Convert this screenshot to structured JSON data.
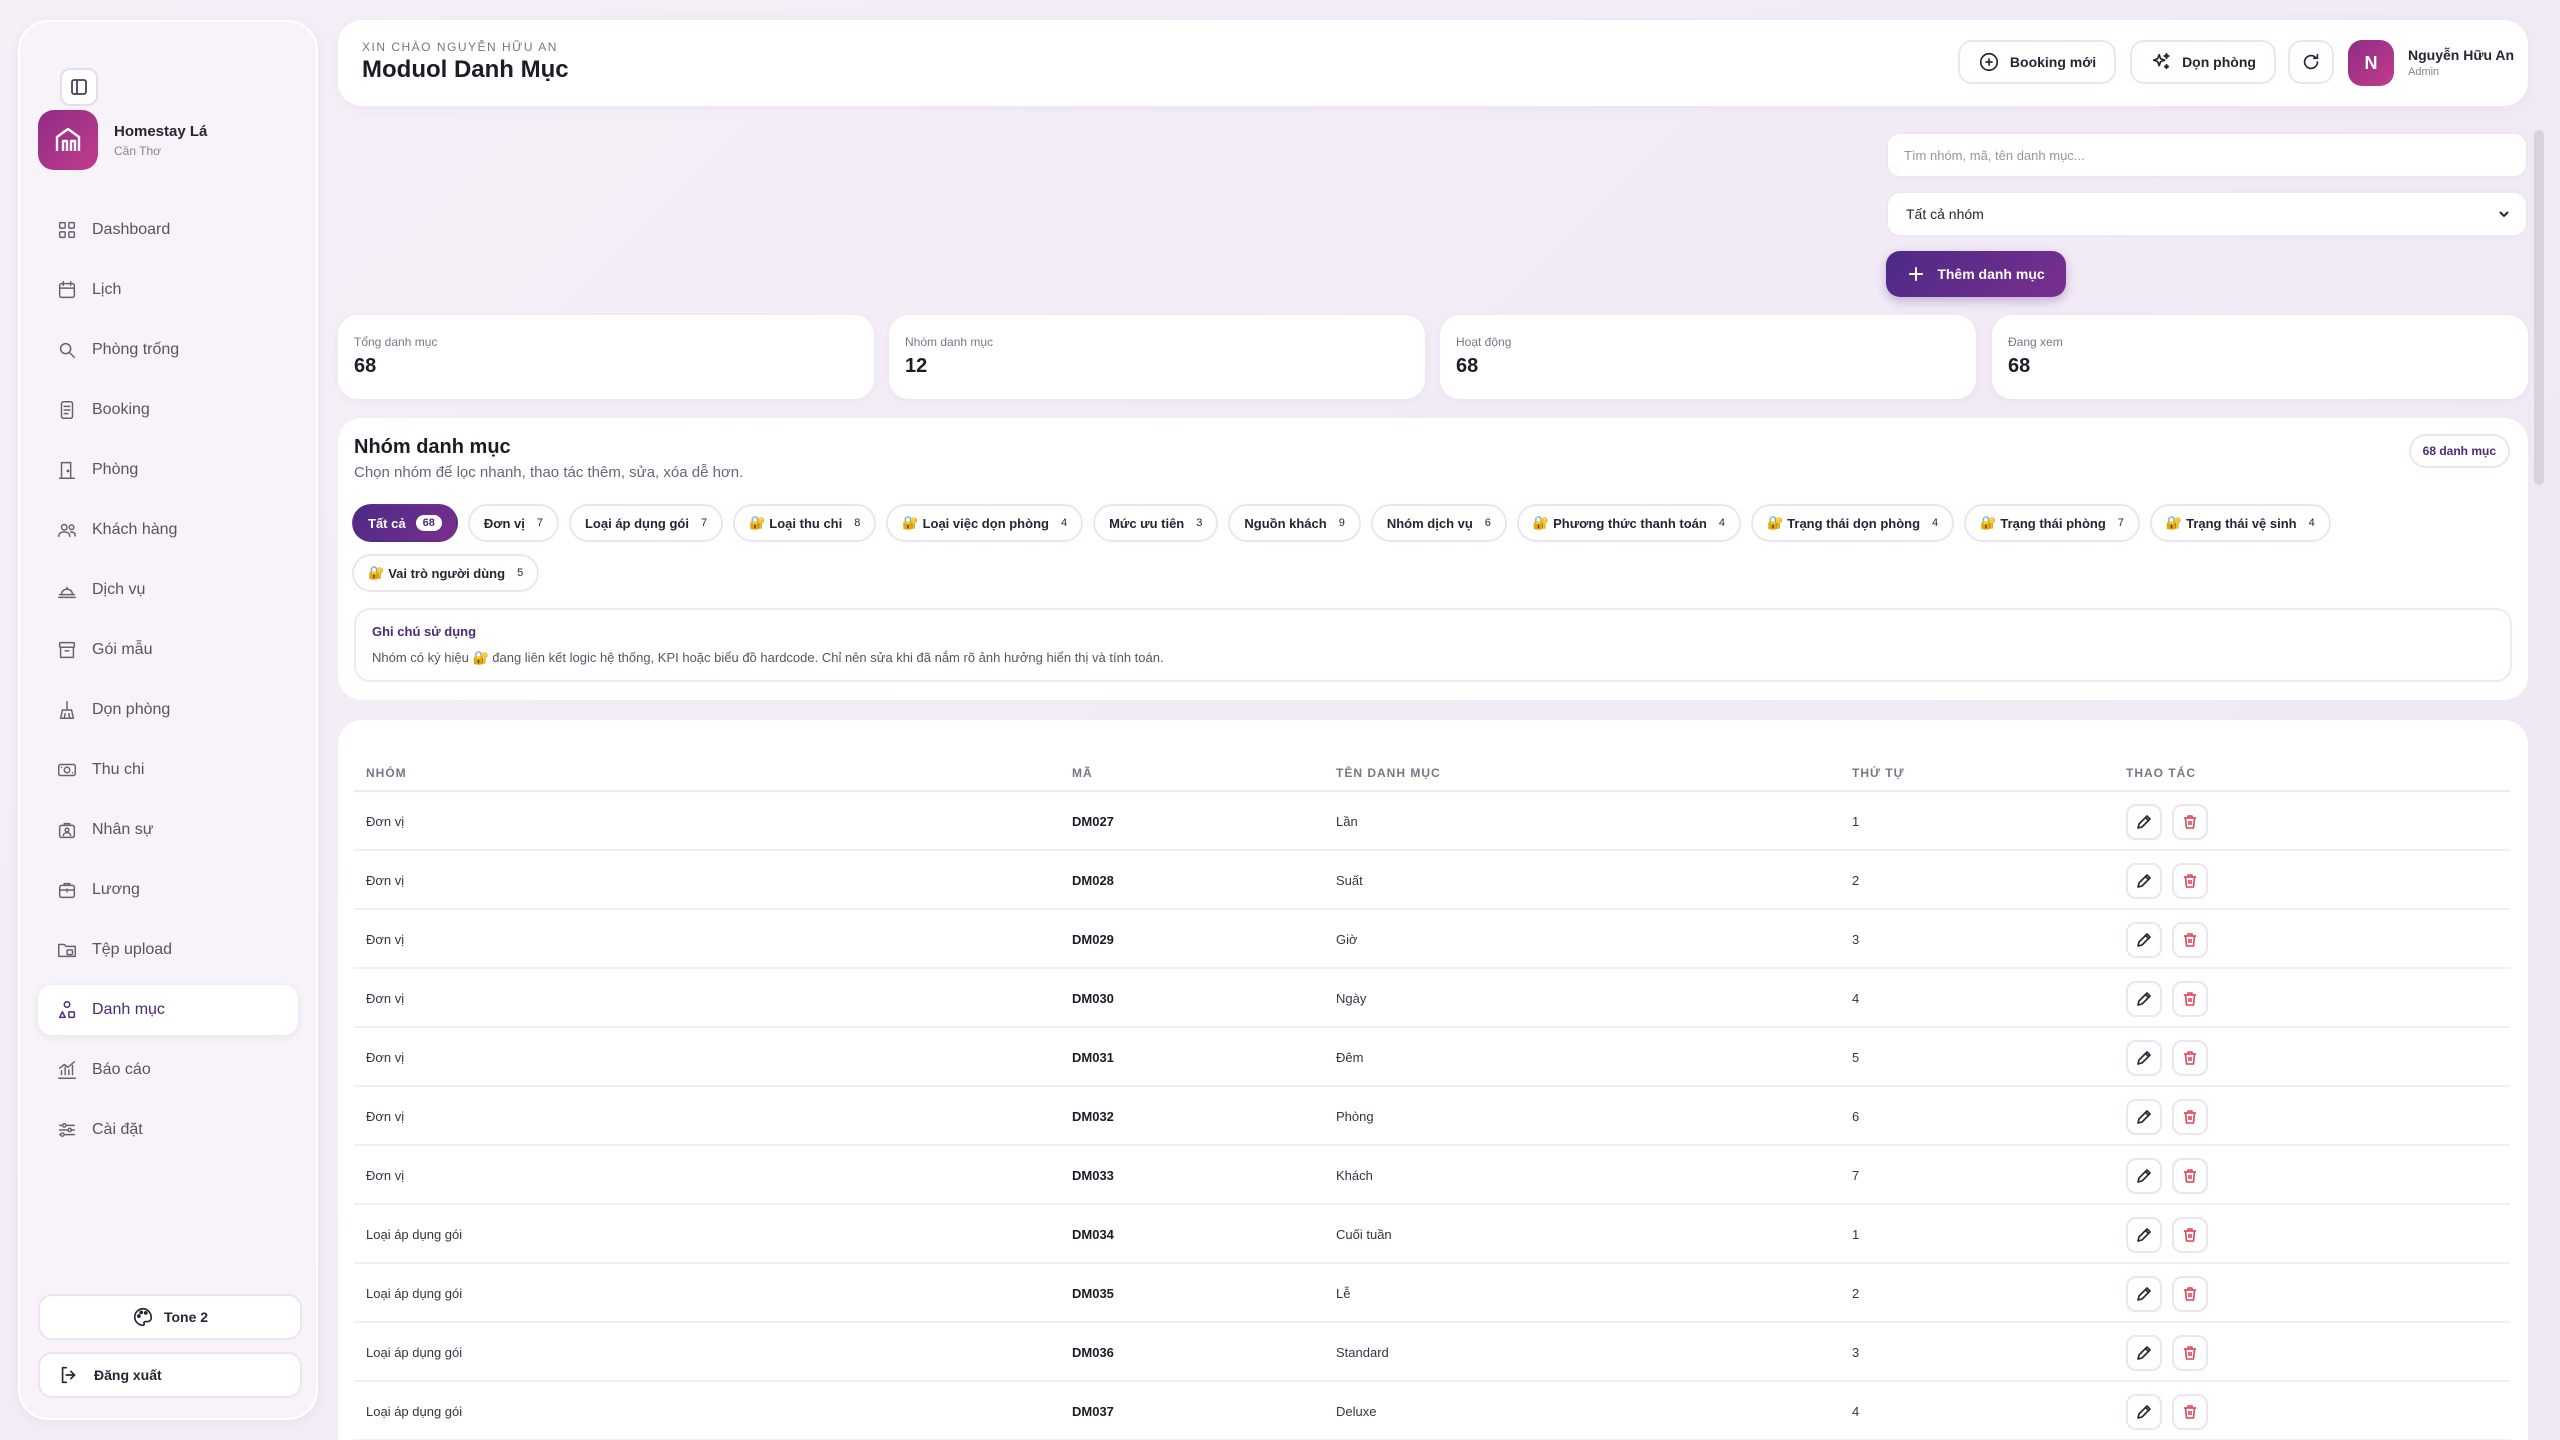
{
  "sidebar": {
    "brand_name": "Homestay Lá",
    "brand_sub": "Cần Thơ",
    "items": [
      {
        "label": "Dashboard",
        "icon": "grid-icon"
      },
      {
        "label": "Lịch",
        "icon": "calendar-icon"
      },
      {
        "label": "Phòng trống",
        "icon": "search-icon"
      },
      {
        "label": "Booking",
        "icon": "booking-icon"
      },
      {
        "label": "Phòng",
        "icon": "door-icon"
      },
      {
        "label": "Khách hàng",
        "icon": "users-icon"
      },
      {
        "label": "Dịch vụ",
        "icon": "service-icon"
      },
      {
        "label": "Gói mẫu",
        "icon": "package-icon"
      },
      {
        "label": "Dọn phòng",
        "icon": "broom-icon"
      },
      {
        "label": "Thu chi",
        "icon": "money-icon"
      },
      {
        "label": "Nhân sự",
        "icon": "staff-icon"
      },
      {
        "label": "Lương",
        "icon": "salary-icon"
      },
      {
        "label": "Tệp upload",
        "icon": "folder-icon"
      },
      {
        "label": "Danh mục",
        "icon": "category-icon"
      },
      {
        "label": "Báo cáo",
        "icon": "chart-icon"
      },
      {
        "label": "Cài đặt",
        "icon": "sliders-icon"
      }
    ],
    "active_index": 13,
    "tone_label": "Tone 2",
    "logout_label": "Đăng xuất"
  },
  "header": {
    "greeting": "XIN CHÀO NGUYỄN HỮU AN",
    "title": "Moduol Danh Mục",
    "booking_label": "Booking mới",
    "clean_label": "Dọn phòng",
    "avatar_initial": "N",
    "user_name": "Nguyễn Hữu An",
    "user_role": "Admin"
  },
  "toolbar": {
    "search_placeholder": "Tìm nhóm, mã, tên danh mục...",
    "filter_value": "Tất cả nhóm",
    "add_label": "Thêm danh mục"
  },
  "stats": [
    {
      "label": "Tổng danh mục",
      "value": "68"
    },
    {
      "label": "Nhóm danh mục",
      "value": "12"
    },
    {
      "label": "Hoạt động",
      "value": "68"
    },
    {
      "label": "Đang xem",
      "value": "68"
    }
  ],
  "groups": {
    "title": "Nhóm danh mục",
    "subtitle": "Chọn nhóm để lọc nhanh, thao tác thêm, sửa, xóa dễ hơn.",
    "badge": "68 danh mục",
    "chips": [
      {
        "label": "Tất cả",
        "count": "68",
        "locked": false
      },
      {
        "label": "Đơn vị",
        "count": "7",
        "locked": false
      },
      {
        "label": "Loại áp dụng gói",
        "count": "7",
        "locked": false
      },
      {
        "label": "Loại thu chi",
        "count": "8",
        "locked": true
      },
      {
        "label": "Loại việc dọn phòng",
        "count": "4",
        "locked": true
      },
      {
        "label": "Mức ưu tiên",
        "count": "3",
        "locked": false
      },
      {
        "label": "Nguồn khách",
        "count": "9",
        "locked": false
      },
      {
        "label": "Nhóm dịch vụ",
        "count": "6",
        "locked": false
      },
      {
        "label": "Phương thức thanh toán",
        "count": "4",
        "locked": true
      },
      {
        "label": "Trạng thái dọn phòng",
        "count": "4",
        "locked": true
      },
      {
        "label": "Trạng thái phòng",
        "count": "7",
        "locked": true
      },
      {
        "label": "Trạng thái vệ sinh",
        "count": "4",
        "locked": true
      },
      {
        "label": "Vai trò người dùng",
        "count": "5",
        "locked": true
      }
    ],
    "lock_glyph": "🔐",
    "note_title": "Ghi chú sử dụng",
    "note_text_before": "Nhóm có ký hiệu",
    "note_text_after": "đang liên kết logic hệ thống, KPI hoặc biểu đồ hardcode. Chỉ nên sửa khi đã nắm rõ ảnh hưởng hiển thị và tính toán."
  },
  "table": {
    "headers": [
      "NHÓM",
      "MÃ",
      "TÊN DANH MỤC",
      "THỨ TỰ",
      "THAO TÁC"
    ],
    "rows": [
      {
        "group": "Đơn vị",
        "code": "DM027",
        "name": "Lần",
        "order": "1"
      },
      {
        "group": "Đơn vị",
        "code": "DM028",
        "name": "Suất",
        "order": "2"
      },
      {
        "group": "Đơn vị",
        "code": "DM029",
        "name": "Giờ",
        "order": "3"
      },
      {
        "group": "Đơn vị",
        "code": "DM030",
        "name": "Ngày",
        "order": "4"
      },
      {
        "group": "Đơn vị",
        "code": "DM031",
        "name": "Đêm",
        "order": "5"
      },
      {
        "group": "Đơn vị",
        "code": "DM032",
        "name": "Phòng",
        "order": "6"
      },
      {
        "group": "Đơn vị",
        "code": "DM033",
        "name": "Khách",
        "order": "7"
      },
      {
        "group": "Loại áp dụng gói",
        "code": "DM034",
        "name": "Cuối tuần",
        "order": "1"
      },
      {
        "group": "Loại áp dụng gói",
        "code": "DM035",
        "name": "Lễ",
        "order": "2"
      },
      {
        "group": "Loại áp dụng gói",
        "code": "DM036",
        "name": "Standard",
        "order": "3"
      },
      {
        "group": "Loại áp dụng gói",
        "code": "DM037",
        "name": "Deluxe",
        "order": "4"
      }
    ]
  },
  "colors": {
    "accent": "#4b2a86",
    "brand": "#a8327f",
    "danger": "#e0445a"
  }
}
